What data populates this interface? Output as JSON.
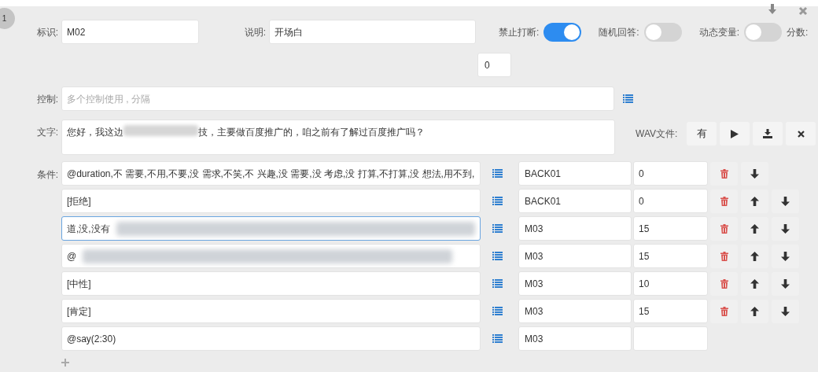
{
  "index_badge": "1",
  "fields": {
    "id": {
      "label": "标识:",
      "value": "M02"
    },
    "desc": {
      "label": "说明:",
      "value": "开场白"
    }
  },
  "toggles": [
    {
      "label": "禁止打断:",
      "on": true
    },
    {
      "label": "随机回答:",
      "on": false
    },
    {
      "label": "动态变量:",
      "on": false
    }
  ],
  "score": {
    "label": "分数:",
    "value": "0"
  },
  "control": {
    "label": "控制:",
    "placeholder": "多个控制使用 , 分隔"
  },
  "text": {
    "label": "文字:",
    "parts": [
      "您好，我这边",
      "技，主要做百度推广的，咱之前有了解过百度推广吗？"
    ]
  },
  "wav": {
    "label": "WAV文件:",
    "buttons": [
      {
        "kind": "text",
        "text": "有"
      },
      {
        "kind": "play"
      },
      {
        "kind": "download"
      },
      {
        "kind": "delete"
      }
    ]
  },
  "conditions_label": "条件:",
  "conditions": [
    {
      "condition": "@duration,不 需要,不用,不要,没 需求,不笑,不 兴趣,没 需要,没 考虑,没 打算,不打算,没 想法,用不到,",
      "target": "BACK01",
      "score": "0",
      "buttons": [
        {
          "kind": "delete"
        },
        {
          "kind": "down"
        }
      ],
      "focused": false,
      "redacted": false
    },
    {
      "condition": "[拒绝]",
      "target": "BACK01",
      "score": "0",
      "buttons": [
        {
          "kind": "delete"
        },
        {
          "kind": "up"
        },
        {
          "kind": "down"
        }
      ],
      "focused": false,
      "redacted": false
    },
    {
      "condition": "道,没,没有",
      "target": "M03",
      "score": "15",
      "buttons": [
        {
          "kind": "delete"
        },
        {
          "kind": "up"
        },
        {
          "kind": "down"
        }
      ],
      "focused": true,
      "redacted": true
    },
    {
      "condition": "@",
      "target": "M03",
      "score": "15",
      "buttons": [
        {
          "kind": "delete"
        },
        {
          "kind": "up"
        },
        {
          "kind": "down"
        }
      ],
      "focused": false,
      "redacted": true
    },
    {
      "condition": "[中性]",
      "target": "M03",
      "score": "10",
      "buttons": [
        {
          "kind": "delete"
        },
        {
          "kind": "up"
        },
        {
          "kind": "down"
        }
      ],
      "focused": false,
      "redacted": false
    },
    {
      "condition": "[肯定]",
      "target": "M03",
      "score": "15",
      "buttons": [
        {
          "kind": "delete"
        },
        {
          "kind": "up"
        },
        {
          "kind": "down"
        }
      ],
      "focused": false,
      "redacted": false
    },
    {
      "condition": "@say(2:30)",
      "target": "M03",
      "focused": false,
      "redacted": false
    }
  ]
}
